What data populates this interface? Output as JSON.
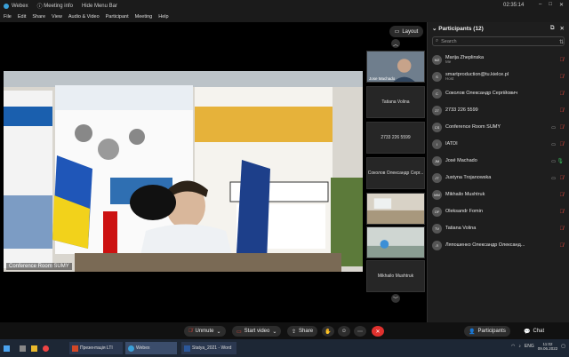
{
  "titlebar": {
    "app_name": "Webex",
    "meeting_info": "Meeting info",
    "hide_menu_bar": "Hide Menu Bar",
    "time": "02:35:14"
  },
  "menu": [
    "File",
    "Edit",
    "Share",
    "View",
    "Audio & Video",
    "Participant",
    "Meeting",
    "Help"
  ],
  "layout_button": "Layout",
  "main_video": {
    "label": "Conference Room SUMY"
  },
  "thumbnails": [
    {
      "label": "Jose Machado",
      "type": "video"
    },
    {
      "label": "Tatiana Volina",
      "type": "name"
    },
    {
      "label": "2733 226 5599",
      "type": "name"
    },
    {
      "label": "Соколов Олександр Серг...",
      "type": "name"
    },
    {
      "label": "",
      "type": "video"
    },
    {
      "label": "",
      "type": "video"
    },
    {
      "label": "Mikhailo Mushtruk",
      "type": "name"
    }
  ],
  "panel": {
    "title": "Participants (12)",
    "search_placeholder": "Search",
    "participants": [
      {
        "initials": "MZ",
        "name": "Marija Zheplinska",
        "role": "Me",
        "status": "muted"
      },
      {
        "initials": "S",
        "name": "smartproduction@tu.kielce.pl",
        "role": "Host",
        "status": "muted"
      },
      {
        "initials": "C",
        "name": "Соколов Олександр Сергійович",
        "role": "",
        "status": "muted"
      },
      {
        "initials": "27",
        "name": "2733 226 5599",
        "role": "",
        "status": "muted"
      },
      {
        "initials": "CS",
        "name": "Conference Room SUMY",
        "role": "",
        "status": "video-muted"
      },
      {
        "initials": "I",
        "name": "IATDI",
        "role": "",
        "status": "video-muted"
      },
      {
        "initials": "JM",
        "name": "José Machado",
        "role": "",
        "status": "video-on"
      },
      {
        "initials": "JT",
        "name": "Justyna Trojanowska",
        "role": "",
        "status": "video-muted"
      },
      {
        "initials": "MM",
        "name": "Mikhailo Mushtruk",
        "role": "",
        "status": "muted"
      },
      {
        "initials": "OF",
        "name": "Oleksandr Fomin",
        "role": "",
        "status": "muted"
      },
      {
        "initials": "TV",
        "name": "Tatiana Volina",
        "role": "",
        "status": "muted"
      },
      {
        "initials": "Л",
        "name": "Ляпошенко Олександр Олександ...",
        "role": "",
        "status": "muted"
      }
    ]
  },
  "controls": {
    "unmute": "Unmute",
    "start_video": "Start video",
    "share": "Share",
    "participants": "Participants",
    "chat": "Chat"
  },
  "taskbar": {
    "apps": [
      "Презентація LTI",
      "Webex",
      "Statya_2021 - Word"
    ],
    "lang": "ENG",
    "time": "11:02",
    "date": "09.06.2022"
  },
  "colors": {
    "mute_red": "#e0473b",
    "end_red": "#e0312e",
    "mic_green": "#3cbf5e",
    "panel_bg": "#1e1e1e"
  }
}
